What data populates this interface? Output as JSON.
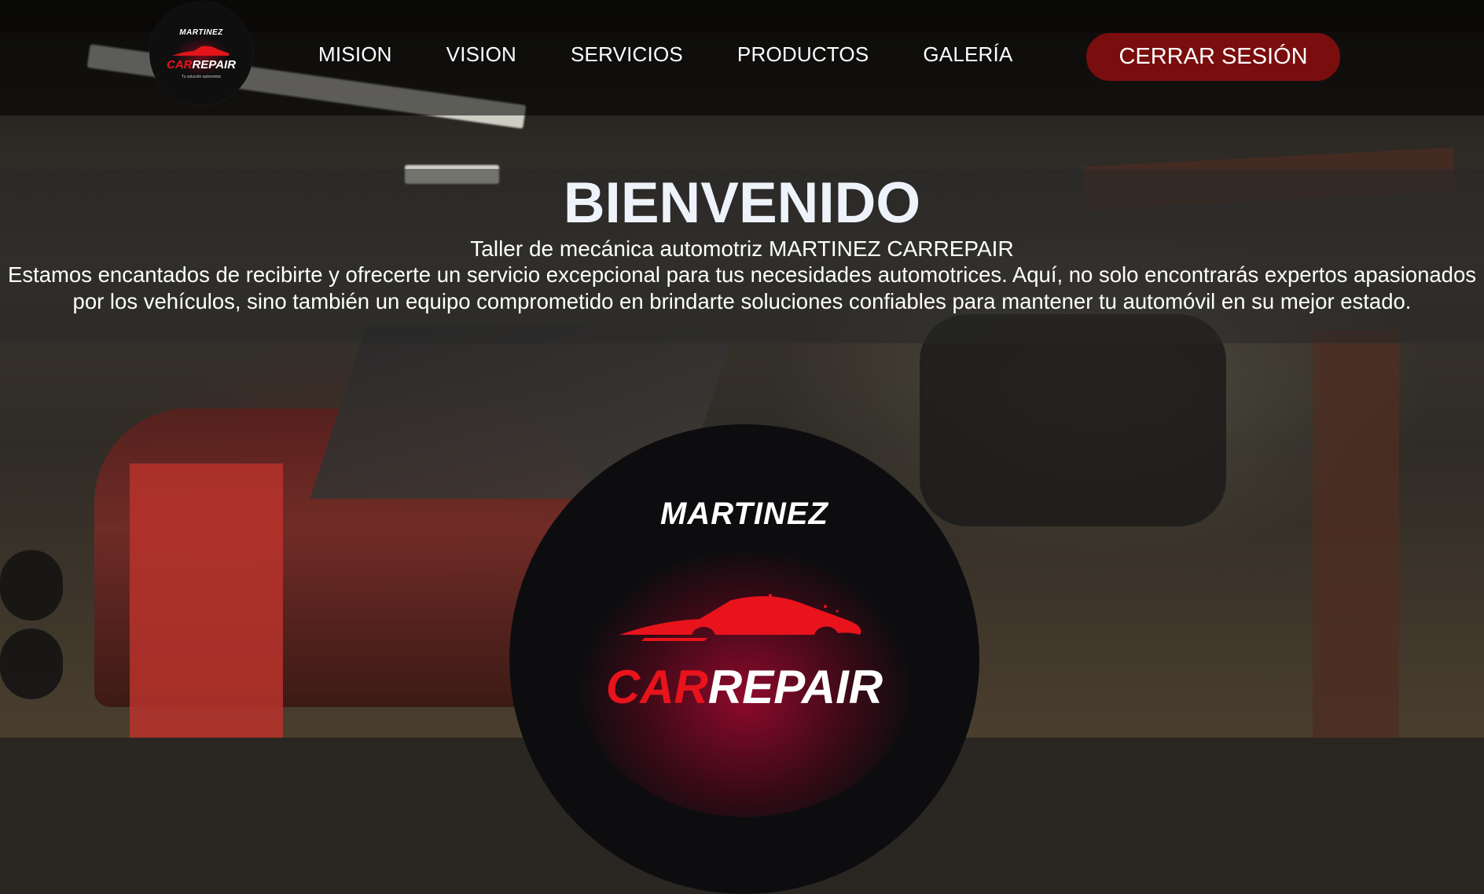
{
  "brand": {
    "logo_top": "MARTINEZ",
    "logo_word_red": "CAR",
    "logo_word_white": "REPAIR",
    "logo_tagline": "Tu solución automotriz",
    "accent_red": "#e5141b",
    "button_red": "#7a0d0d"
  },
  "nav": {
    "items": [
      {
        "label": "MISION"
      },
      {
        "label": "VISION"
      },
      {
        "label": "SERVICIOS"
      },
      {
        "label": "PRODUCTOS"
      },
      {
        "label": "GALERÍA"
      }
    ],
    "logout_label": "CERRAR SESIÓN"
  },
  "welcome": {
    "title": "BIENVENIDO",
    "subtitle": "Taller de mecánica automotriz MARTINEZ CARREPAIR",
    "text": "Estamos encantados de recibirte y ofrecerte un servicio excepcional para tus necesidades automotrices. Aquí, no solo encontrarás expertos apasionados por los vehículos, sino también un equipo comprometido en brindarte soluciones confiables para mantener tu automóvil en su mejor estado."
  }
}
